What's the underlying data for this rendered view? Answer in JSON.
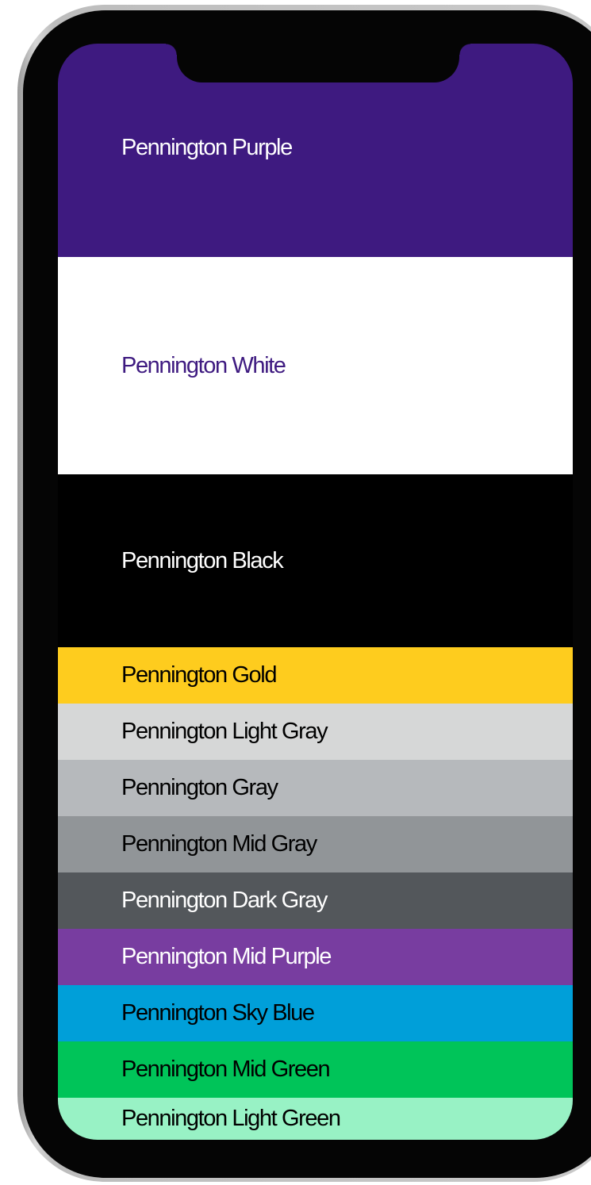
{
  "swatches": [
    {
      "label": "Pennington Purple",
      "bg": "#3e1a80",
      "fg": "#ffffff"
    },
    {
      "label": "Pennington White",
      "bg": "#ffffff",
      "fg": "#3e1a80"
    },
    {
      "label": "Pennington Black",
      "bg": "#000000",
      "fg": "#ffffff"
    },
    {
      "label": "Pennington Gold",
      "bg": "#fecc1e",
      "fg": "#000000"
    },
    {
      "label": "Pennington Light Gray",
      "bg": "#d6d7d7",
      "fg": "#000000"
    },
    {
      "label": "Pennington Gray",
      "bg": "#b6b9bc",
      "fg": "#000000"
    },
    {
      "label": "Pennington Mid Gray",
      "bg": "#919598",
      "fg": "#000000"
    },
    {
      "label": "Pennington Dark Gray",
      "bg": "#53575b",
      "fg": "#ffffff"
    },
    {
      "label": "Pennington Mid Purple",
      "bg": "#783da0",
      "fg": "#ffffff"
    },
    {
      "label": "Pennington Sky Blue",
      "bg": "#009fd9",
      "fg": "#000000"
    },
    {
      "label": "Pennington Mid Green",
      "bg": "#00c459",
      "fg": "#000000"
    },
    {
      "label": "Pennington Light Green",
      "bg": "#98f2c5",
      "fg": "#000000"
    }
  ]
}
